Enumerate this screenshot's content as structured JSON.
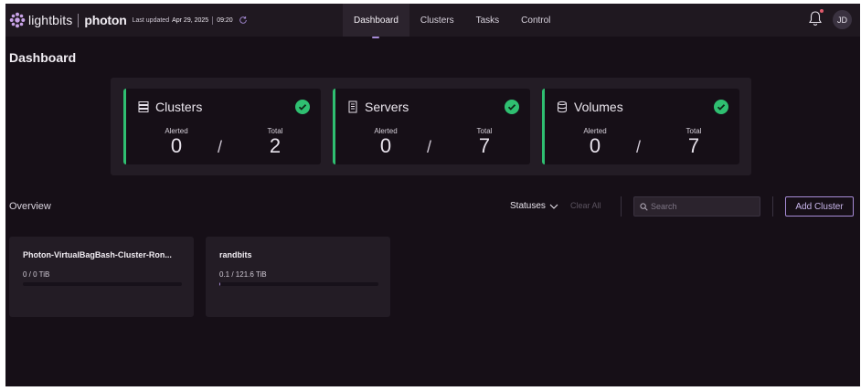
{
  "header": {
    "brand": "lightbits",
    "product": "photon",
    "last_updated_label": "Last updated",
    "last_updated_date": "Apr 29, 2025",
    "last_updated_time": "09:20",
    "user_initials": "JD",
    "nav": [
      {
        "label": "Dashboard",
        "active": true
      },
      {
        "label": "Clusters",
        "active": false
      },
      {
        "label": "Tasks",
        "active": false
      },
      {
        "label": "Control",
        "active": false
      }
    ]
  },
  "page": {
    "title": "Dashboard"
  },
  "summary": [
    {
      "title": "Clusters",
      "icon": "clusters-icon",
      "alerted_label": "Alerted",
      "alerted": "0",
      "total_label": "Total",
      "total": "2",
      "status": "ok"
    },
    {
      "title": "Servers",
      "icon": "server-icon",
      "alerted_label": "Alerted",
      "alerted": "0",
      "total_label": "Total",
      "total": "7",
      "status": "ok"
    },
    {
      "title": "Volumes",
      "icon": "database-icon",
      "alerted_label": "Alerted",
      "alerted": "0",
      "total_label": "Total",
      "total": "7",
      "status": "ok"
    }
  ],
  "overview": {
    "label": "Overview",
    "statuses_label": "Statuses",
    "clear_all_label": "Clear All",
    "search_placeholder": "Search",
    "add_button_label": "Add Cluster"
  },
  "clusters": [
    {
      "name": "Photon-VirtualBagBash-Cluster-Ron...",
      "usage": "0 / 0 TiB",
      "used_fraction": 0
    },
    {
      "name": "randbits",
      "usage": "0.1 / 121.6 TiB",
      "used_fraction": 0.0008
    }
  ],
  "colors": {
    "background": "#160f17",
    "accent": "#a68bd6",
    "status_ok": "#2fbf71",
    "notification": "#e05a6c"
  }
}
